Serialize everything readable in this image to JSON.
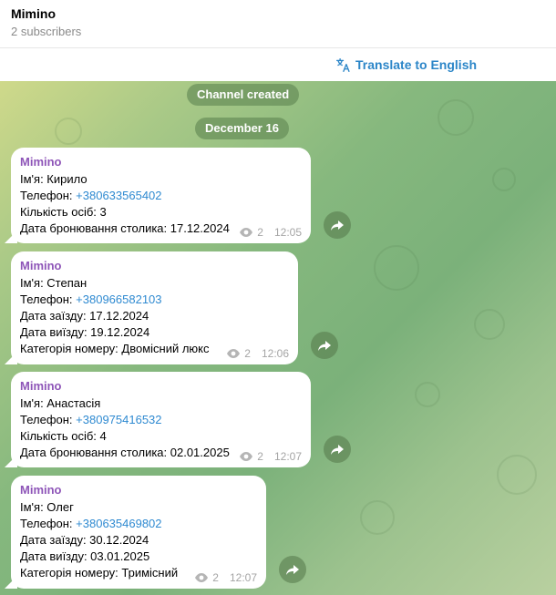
{
  "channel": {
    "title": "Mimino",
    "subscribers": "2 subscribers"
  },
  "translate": {
    "label": "Translate to English",
    "icon": "translate-icon"
  },
  "service": {
    "created": "Channel created",
    "date": "December 16"
  },
  "colors": {
    "accent": "#2c86c8",
    "author": "#8e55b8",
    "link": "#2f8ad1"
  },
  "messages": [
    {
      "author": "Mimino",
      "lines": [
        {
          "text": "Ім'я: Кирило"
        },
        {
          "prefix": "Телефон: ",
          "phone": "+380633565402"
        },
        {
          "text": "Кількість осіб: 3"
        },
        {
          "text": "Дата бронювання столика: 17.12.2024"
        }
      ],
      "views": "2",
      "time": "12:05"
    },
    {
      "author": "Mimino",
      "lines": [
        {
          "text": "Ім'я: Степан"
        },
        {
          "prefix": "Телефон: ",
          "phone": "+380966582103"
        },
        {
          "text": "Дата заїзду: 17.12.2024"
        },
        {
          "text": "Дата виїзду: 19.12.2024"
        },
        {
          "text": "Категорія номеру: Двомісний люкс"
        }
      ],
      "views": "2",
      "time": "12:06"
    },
    {
      "author": "Mimino",
      "lines": [
        {
          "text": "Ім'я: Анастасія"
        },
        {
          "prefix": "Телефон: ",
          "phone": "+380975416532"
        },
        {
          "text": "Кількість осіб: 4"
        },
        {
          "text": "Дата бронювання столика: 02.01.2025"
        }
      ],
      "views": "2",
      "time": "12:07"
    },
    {
      "author": "Mimino",
      "lines": [
        {
          "text": "Ім'я: Олег"
        },
        {
          "prefix": "Телефон: ",
          "phone": "+380635469802"
        },
        {
          "text": "Дата заїзду: 30.12.2024"
        },
        {
          "text": "Дата виїзду: 03.01.2025"
        },
        {
          "text": "Категорія номеру: Тримісний"
        }
      ],
      "views": "2",
      "time": "12:07"
    }
  ]
}
